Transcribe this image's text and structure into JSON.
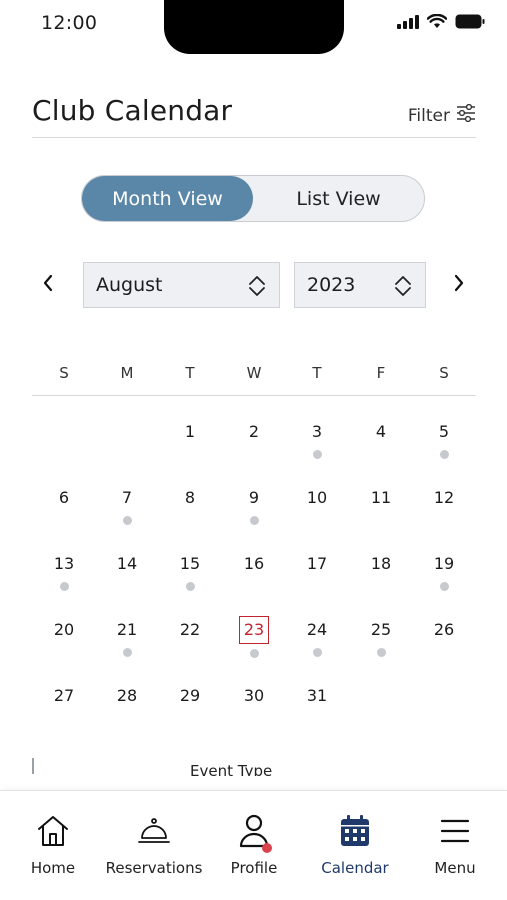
{
  "status_bar": {
    "time": "12:00"
  },
  "header": {
    "title": "Club Calendar",
    "filter_label": "Filter"
  },
  "view_toggle": {
    "month": "Month View",
    "list": "List View"
  },
  "month_picker": {
    "month": "August",
    "year": "2023"
  },
  "weekdays": [
    "S",
    "M",
    "T",
    "W",
    "T",
    "F",
    "S"
  ],
  "days": {
    "d1": "1",
    "d2": "2",
    "d3": "3",
    "d4": "4",
    "d5": "5",
    "d6": "6",
    "d7": "7",
    "d8": "8",
    "d9": "9",
    "d10": "10",
    "d11": "11",
    "d12": "12",
    "d13": "13",
    "d14": "14",
    "d15": "15",
    "d16": "16",
    "d17": "17",
    "d18": "18",
    "d19": "19",
    "d20": "20",
    "d21": "21",
    "d22": "22",
    "d23": "23",
    "d24": "24",
    "d25": "25",
    "d26": "26",
    "d27": "27",
    "d28": "28",
    "d29": "29",
    "d30": "30",
    "d31": "31"
  },
  "event_days": [
    3,
    5,
    7,
    9,
    13,
    15,
    19,
    21,
    23,
    24,
    25
  ],
  "selected_day": 23,
  "event_type_heading": "Event Type",
  "tabs": {
    "home": "Home",
    "reservations": "Reservations",
    "profile": "Profile",
    "calendar": "Calendar",
    "menu": "Menu"
  },
  "colors": {
    "accent": "#5a86a8",
    "today": "#c2242f",
    "active_tab": "#1f3a6a",
    "event_dot": "#c6c9ce",
    "badge": "#d8434d"
  }
}
